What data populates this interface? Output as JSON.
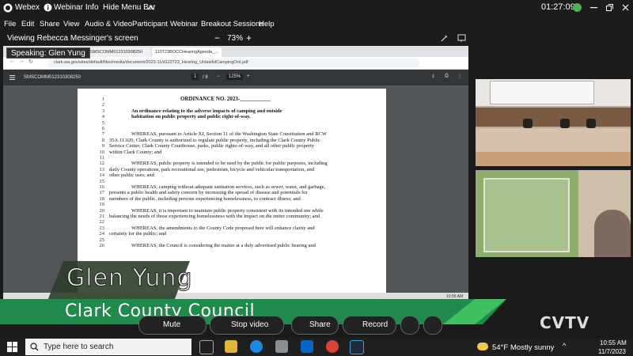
{
  "titlebar": {
    "app_name": "Webex",
    "webinar_info": "Webinar Info",
    "hide_menu_bar": "Hide Menu Bar",
    "clock": "01:27:09"
  },
  "menu": [
    "File",
    "Edit",
    "Share",
    "View",
    "Audio & Video",
    "Participant",
    "Webinar",
    "Breakout Sessions",
    "Help"
  ],
  "viewbar": {
    "viewing_text": "Viewing Rebecca Messinger's screen",
    "zoom_minus": "−",
    "zoom_level": "73%",
    "zoom_plus": "+"
  },
  "speaking_badge": "Speaking: Glen Yung",
  "browser": {
    "tabs": [
      "SMSCOMM012310308250",
      "110723BOCCHearingAgenda_..."
    ],
    "url": "clark.wa.gov/sites/default/files/media/document/2023-11/d110723_Hearing_UnlawfulCampingOrd.pdf",
    "pdf_title": "SMSCOMM012310308250",
    "page_current": "1",
    "page_total": "/ 8",
    "pdf_zoom": "125%"
  },
  "document": {
    "lines": [
      {
        "n": "1",
        "text": "ORDINANCE NO. 2023-___________",
        "style": "title"
      },
      {
        "n": "2",
        "text": "",
        "style": ""
      },
      {
        "n": "3",
        "text": "An ordinance relating to the adverse impacts of camping and outside",
        "style": "bold"
      },
      {
        "n": "4",
        "text": "habitation on public property and public right-of-way.",
        "style": "bold"
      },
      {
        "n": "5",
        "text": "",
        "style": ""
      },
      {
        "n": "6",
        "text": "",
        "style": ""
      },
      {
        "n": "7",
        "text": "WHEREAS, pursuant to Article XI, Section 11 of the Washington State Constitution and RCW",
        "style": "indent"
      },
      {
        "n": "8",
        "text": "35A.11.020, Clark County is authorized to regulate public property, including the Clark County Public",
        "style": ""
      },
      {
        "n": "9",
        "text": "Service Center, Clark County Courthouse, parks, public rights-of-way, and all other public property",
        "style": ""
      },
      {
        "n": "10",
        "text": "within Clark County; and",
        "style": ""
      },
      {
        "n": "11",
        "text": "",
        "style": ""
      },
      {
        "n": "12",
        "text": "WHEREAS, public property is intended to be used by the public for public purposes, including",
        "style": "indent"
      },
      {
        "n": "13",
        "text": "daily County operations, park recreational use, pedestrian, bicycle and vehicular transportation, and",
        "style": ""
      },
      {
        "n": "14",
        "text": "other public uses; and",
        "style": ""
      },
      {
        "n": "15",
        "text": "",
        "style": ""
      },
      {
        "n": "16",
        "text": "WHEREAS, camping without adequate sanitation services, such as sewer, water, and garbage,",
        "style": "indent"
      },
      {
        "n": "17",
        "text": "presents a public health and safety concern by increasing the spread of disease and potentials for",
        "style": ""
      },
      {
        "n": "18",
        "text": "members of the public, including persons experiencing homelessness, to contract illness; and",
        "style": ""
      },
      {
        "n": "19",
        "text": "",
        "style": ""
      },
      {
        "n": "20",
        "text": "WHEREAS, it is important to maintain public property consistent with its intended use while",
        "style": "indent"
      },
      {
        "n": "21",
        "text": "balancing the needs of those experiencing homelessness with the impact on the entire community; and",
        "style": ""
      },
      {
        "n": "22",
        "text": "",
        "style": ""
      },
      {
        "n": "23",
        "text": "WHEREAS, the amendments to the County Code proposed here will enhance clarity and",
        "style": "indent"
      },
      {
        "n": "24",
        "text": "certainty for the public; and",
        "style": ""
      },
      {
        "n": "25",
        "text": "",
        "style": ""
      },
      {
        "n": "26",
        "text": "WHEREAS, the Council is considering the matter at a duly advertised public hearing and",
        "style": "indent"
      }
    ]
  },
  "shared_taskbar_time": "10:55 AM",
  "lower_third": {
    "name": "Glen Yung",
    "title": "Clark County Council"
  },
  "controls": {
    "mute": "Mute",
    "stop_video": "Stop video",
    "share": "Share",
    "record": "Record"
  },
  "watermark": "CVTV",
  "taskbar": {
    "search_placeholder": "Type here to search",
    "weather_temp": "54°F",
    "weather_desc": "Mostly sunny",
    "time": "10:55 AM",
    "date": "11/7/2023"
  },
  "colors": {
    "lower_third_green": "#1f8a4c",
    "lower_third_dark": "#2e3d2a",
    "webex_bg": "#1c1c1c",
    "pdf_toolbar": "#323639"
  }
}
